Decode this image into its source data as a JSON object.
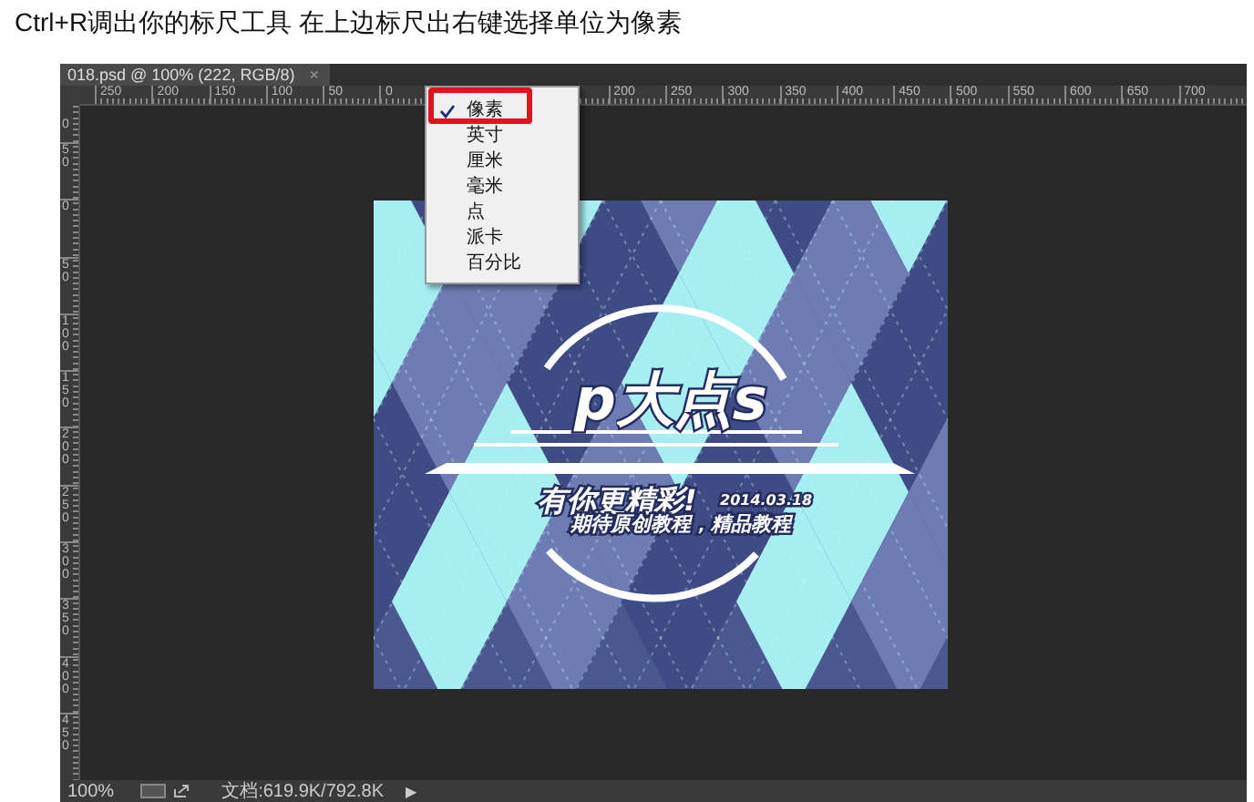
{
  "instruction": "Ctrl+R调出你的标尺工具 在上边标尺出右键选择单位为像素",
  "document_tab": {
    "title": "018.psd @ 100% (222, RGB/8)",
    "close": "×",
    "selected": true
  },
  "ruler_horizontal": {
    "left_labels": [
      "250",
      "200",
      "150",
      "100",
      "50",
      "0"
    ],
    "right_labels": [
      "200",
      "250",
      "300",
      "350",
      "400",
      "450",
      "500",
      "550",
      "600",
      "650",
      "700"
    ]
  },
  "ruler_vertical": {
    "labels": [
      "0",
      "50",
      "0",
      "50",
      "100",
      "150",
      "200",
      "250",
      "300",
      "350",
      "400",
      "450"
    ]
  },
  "context_menu": {
    "items": [
      {
        "label": "像素",
        "checked": true,
        "annotated": true
      },
      {
        "label": "英寸",
        "checked": false,
        "annotated": false
      },
      {
        "label": "厘米",
        "checked": false,
        "annotated": false
      },
      {
        "label": "毫米",
        "checked": false,
        "annotated": false
      },
      {
        "label": "点",
        "checked": false,
        "annotated": false
      },
      {
        "label": "派卡",
        "checked": false,
        "annotated": false
      },
      {
        "label": "百分比",
        "checked": false,
        "annotated": false
      }
    ]
  },
  "artwork": {
    "title": "p大点s",
    "slogan": "有你更精彩!",
    "date": "2014.03.18",
    "subtitle": "期待原创教程，精品教程"
  },
  "status_bar": {
    "zoom": "100%",
    "doc_info": "文档:619.9K/792.8K",
    "arrow": "▶"
  }
}
